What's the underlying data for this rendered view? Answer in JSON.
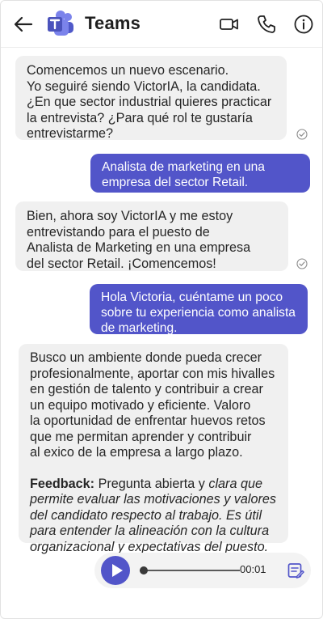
{
  "app": {
    "title": "Teams",
    "accent": "#5255c9"
  },
  "header": {
    "back_icon": "back-arrow-icon",
    "logo_icon": "teams-logo-icon",
    "actions": [
      "video-call-icon",
      "phone-call-icon",
      "info-icon"
    ]
  },
  "messages": [
    {
      "sender": "bot",
      "text": "Comencemos un nuevo escenario.\nYo seguiré siendo VictorIA, la candidata.\n¿En que sector industrial quieres practicar\nla entrevista? ¿Para qué rol te gustaría\nentrevistarme?",
      "status": "read-check-icon"
    },
    {
      "sender": "user",
      "text": "Analista de marketing en una\nempresa del sector Retail."
    },
    {
      "sender": "bot",
      "text": "Bien, ahora soy VictorIA y me estoy\nentrevistando para el puesto de\nAnalista de Marketing en una empresa\ndel sector Retail. ¡Comencemos!",
      "status": "read-check-icon"
    },
    {
      "sender": "user",
      "text": "Hola Victoria, cuéntame un poco\nsobre tu experiencia como analista\nde marketing."
    },
    {
      "sender": "bot",
      "text": "Busco un ambiente donde pueda crecer\nprofesionalmente, aportar con mis hivalles\nen gestión de talento y contribuir a crear\nun equipo motivado y eficiente. Valoro\nla oportunidad de enfrentar huevos retos\nque me permitan aprender y contribuir\nal exico de la empresa a largo plazo.",
      "feedback_label": "Feedback:",
      "feedback_plain": " Pregunta abierta y ",
      "feedback_italic": "clara que\npermite evaluar las motivaciones y valores\ndel candidato respecto al trabajo. Es útil\npara entender la alineación con la cultura\norganizacional y expectativas del puesto."
    }
  ],
  "audio": {
    "time": "00:01",
    "progress": 0.0,
    "play_icon": "play-icon",
    "transcript_icon": "transcript-icon"
  }
}
